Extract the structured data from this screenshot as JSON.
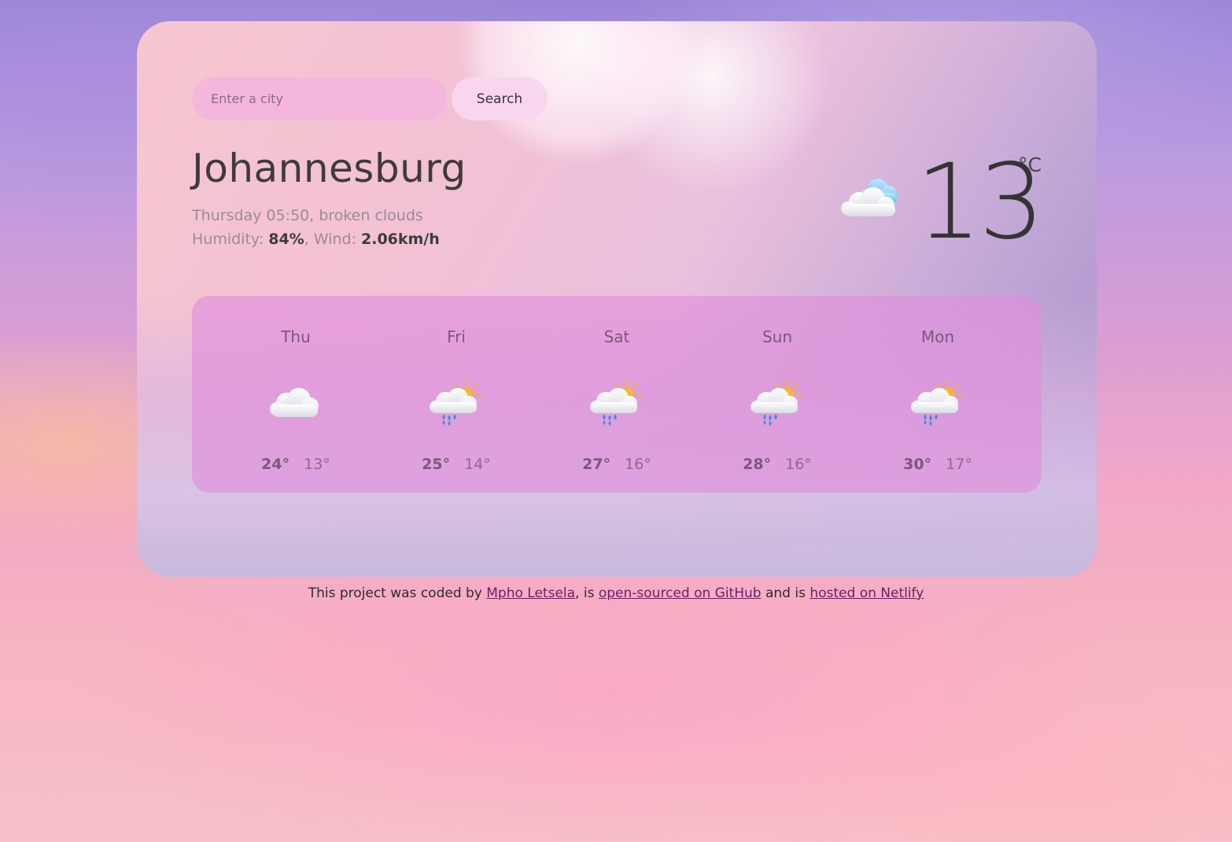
{
  "search": {
    "placeholder": "Enter a city",
    "button_label": "Search"
  },
  "current": {
    "city": "Johannesburg",
    "day_time": "Thursday 05:50",
    "description": "broken clouds",
    "humidity_label": "Humidity:",
    "humidity_value": "84%",
    "wind_label": "Wind:",
    "wind_value": "2.06km/h",
    "temperature": "13",
    "unit": "°C",
    "icon": "broken-clouds-icon"
  },
  "forecast": [
    {
      "day": "Thu",
      "max": "24°",
      "min": "13°",
      "icon": "cloud-icon"
    },
    {
      "day": "Fri",
      "max": "25°",
      "min": "14°",
      "icon": "sun-cloud-rain-icon"
    },
    {
      "day": "Sat",
      "max": "27°",
      "min": "16°",
      "icon": "sun-cloud-rain-icon"
    },
    {
      "day": "Sun",
      "max": "28°",
      "min": "16°",
      "icon": "sun-cloud-rain-icon"
    },
    {
      "day": "Mon",
      "max": "30°",
      "min": "17°",
      "icon": "sun-cloud-rain-icon"
    }
  ],
  "footer": {
    "text_1": "This project was coded by ",
    "author_link": "Mpho Letsela",
    "text_2": ", is ",
    "github_link": "open-sourced on GitHub",
    "text_3": " and is ",
    "netlify_link": "hosted on Netlify"
  },
  "colors": {
    "card_text": "#3d3b3c",
    "muted_text": "#9c8a96",
    "forecast_panel": "#e18cdc",
    "link": "#6a1f66"
  }
}
